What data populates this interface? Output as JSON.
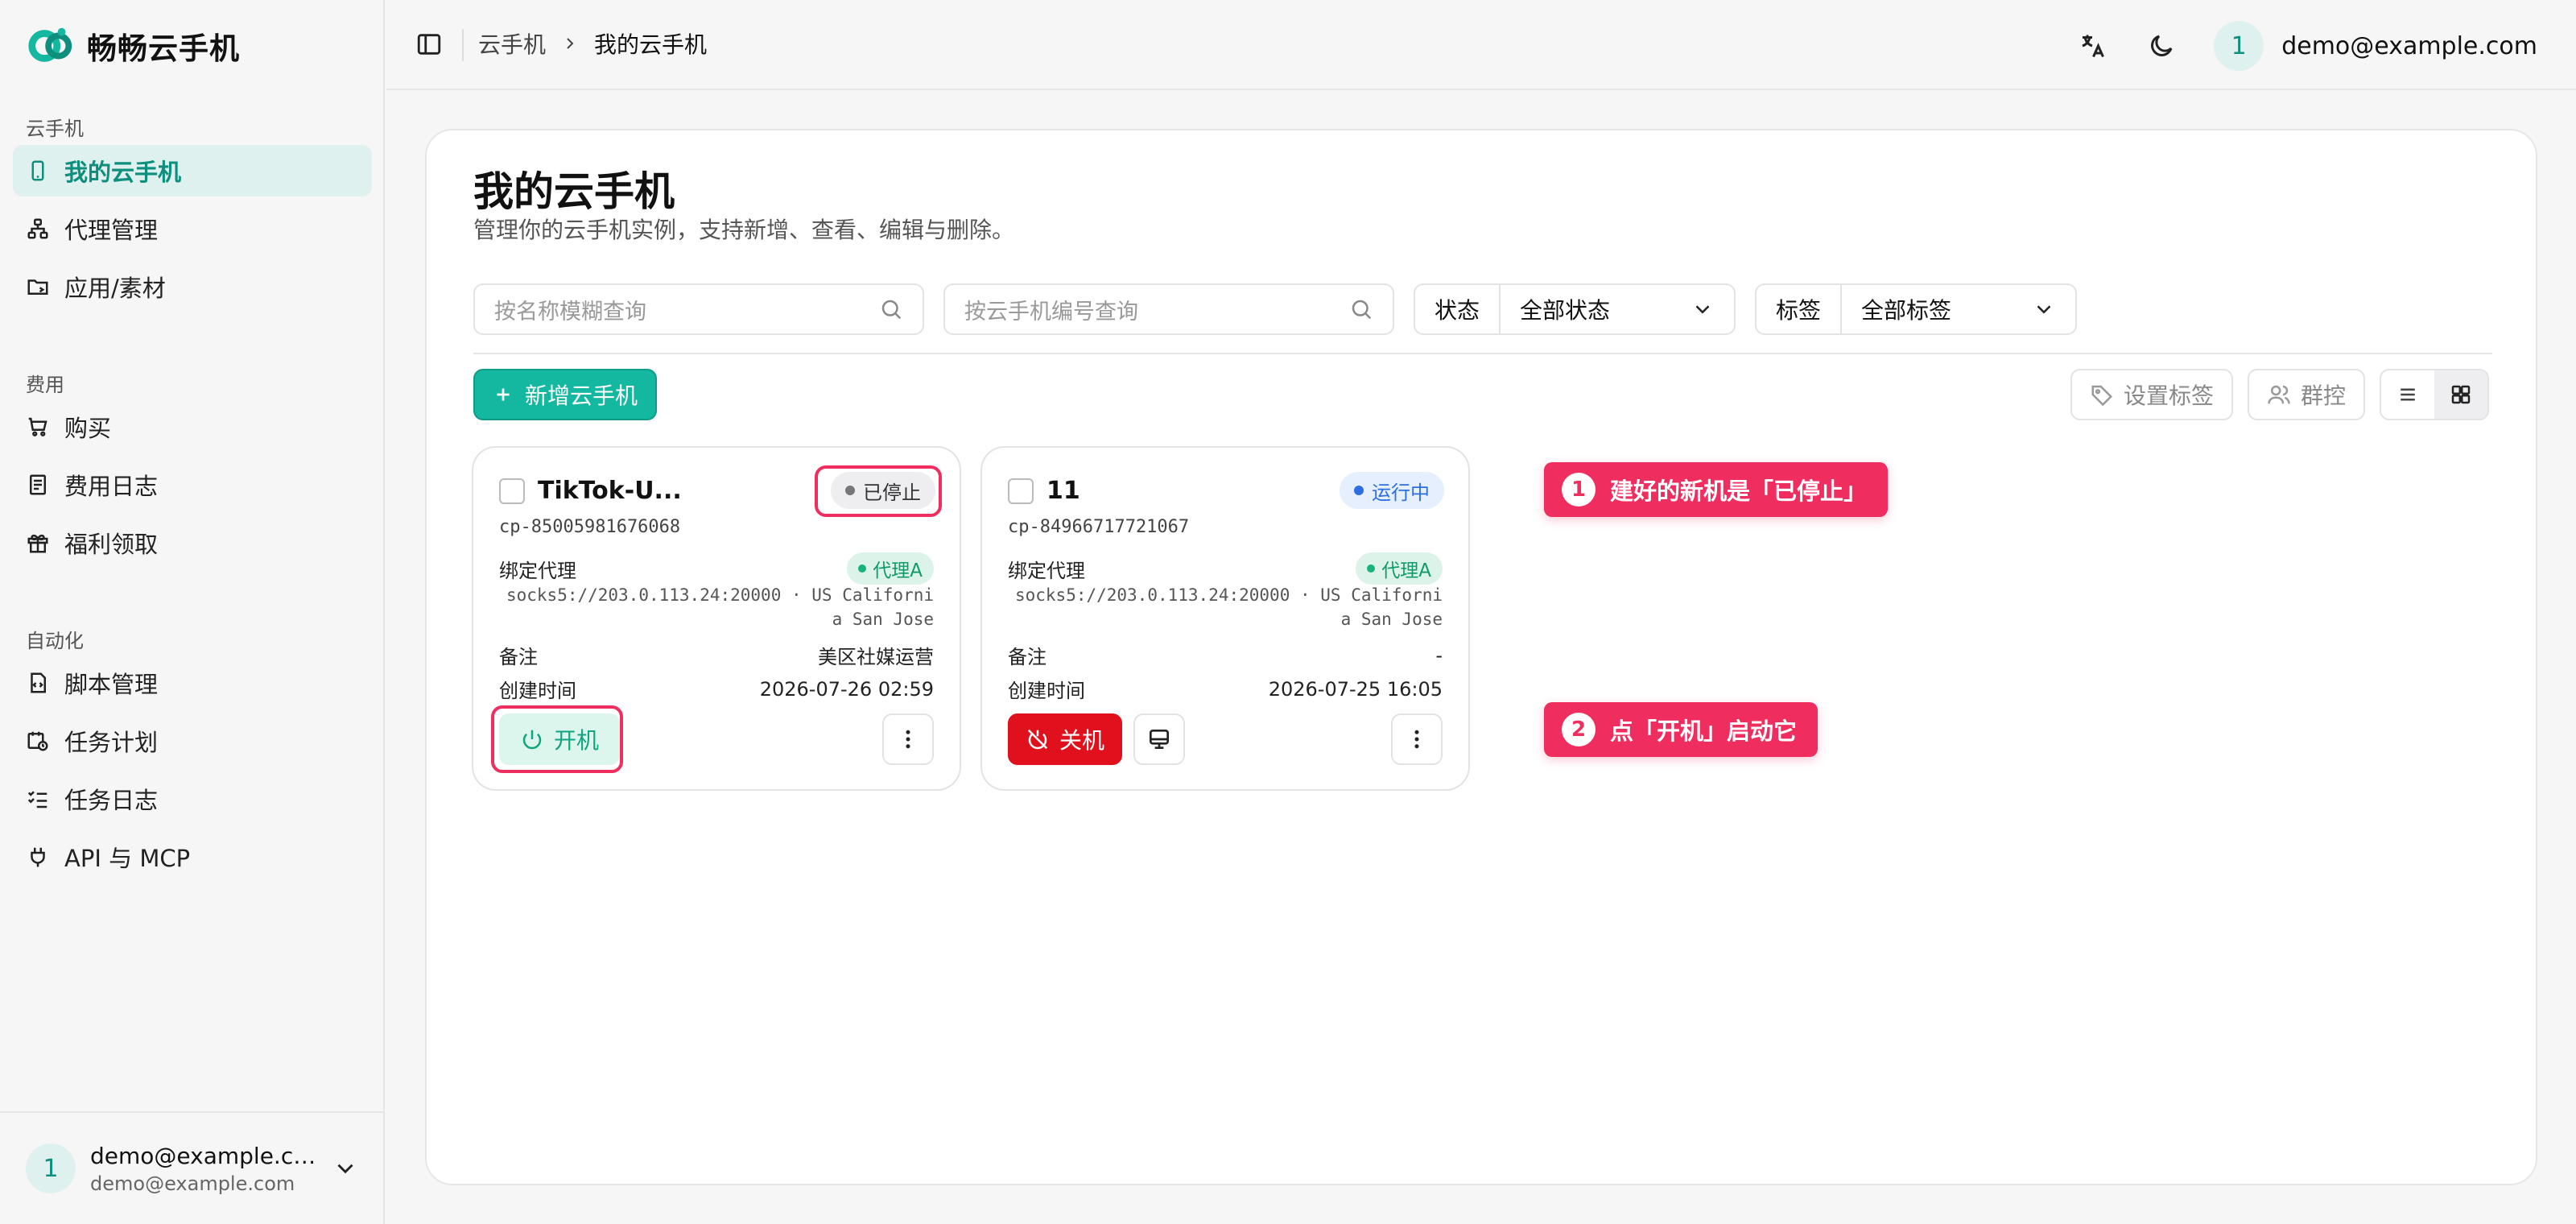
{
  "brand": {
    "name": "畅畅云手机"
  },
  "sidebar": {
    "groups": [
      {
        "title": "云手机",
        "items": [
          {
            "label": "我的云手机",
            "icon": "phone-icon",
            "active": true
          },
          {
            "label": "代理管理",
            "icon": "network-icon"
          },
          {
            "label": "应用/素材",
            "icon": "folder-icon"
          }
        ]
      },
      {
        "title": "费用",
        "items": [
          {
            "label": "购买",
            "icon": "cart-icon"
          },
          {
            "label": "费用日志",
            "icon": "receipt-icon"
          },
          {
            "label": "福利领取",
            "icon": "gift-icon"
          }
        ]
      },
      {
        "title": "自动化",
        "items": [
          {
            "label": "脚本管理",
            "icon": "script-icon"
          },
          {
            "label": "任务计划",
            "icon": "calendar-clock-icon"
          },
          {
            "label": "任务日志",
            "icon": "checklist-icon"
          },
          {
            "label": "API 与 MCP",
            "icon": "plug-icon"
          }
        ]
      }
    ],
    "user": {
      "initial": "1",
      "name": "demo@example.co...",
      "email": "demo@example.com"
    }
  },
  "header": {
    "breadcrumb": [
      "云手机",
      "我的云手机"
    ],
    "user": {
      "initial": "1",
      "email": "demo@example.com"
    }
  },
  "page": {
    "title": "我的云手机",
    "subtitle": "管理你的云手机实例，支持新增、查看、编辑与删除。",
    "filters": {
      "name_placeholder": "按名称模糊查询",
      "id_placeholder": "按云手机编号查询",
      "status_label": "状态",
      "status_value": "全部状态",
      "tag_label": "标签",
      "tag_value": "全部标签"
    },
    "add_button": "新增云手机",
    "tools": {
      "set_tag": "设置标签",
      "group_control": "群控"
    }
  },
  "cards": [
    {
      "name": "TikTok-U...",
      "status": "已停止",
      "id": "cp-85005981676068",
      "proxy_label": "绑定代理",
      "proxy_name": "代理A",
      "proxy_url": "socks5://203.0.113.24:20000 · US California San Jose",
      "note_label": "备注",
      "note_value": "美区社媒运营",
      "created_label": "创建时间",
      "created_value": "2026-07-26 02:59",
      "power_label": "开机"
    },
    {
      "name": "11",
      "status": "运行中",
      "id": "cp-84966717721067",
      "proxy_label": "绑定代理",
      "proxy_name": "代理A",
      "proxy_url": "socks5://203.0.113.24:20000 · US California San Jose",
      "note_label": "备注",
      "note_value": "-",
      "created_label": "创建时间",
      "created_value": "2026-07-25 16:05",
      "power_label": "关机"
    }
  ],
  "callouts": [
    {
      "num": "1",
      "text": "建好的新机是「已停止」"
    },
    {
      "num": "2",
      "text": "点「开机」启动它"
    }
  ],
  "colors": {
    "accent": "#14b8a0",
    "callout": "#ef2e5f",
    "danger": "#e0101d",
    "running": "#2e6fe0"
  }
}
